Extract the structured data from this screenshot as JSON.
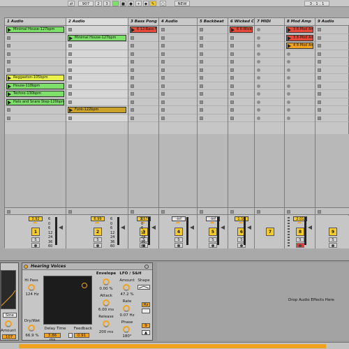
{
  "toolbar": {
    "bpm": "907",
    "bar_position": "2",
    "beat_position": "3",
    "new_button": "NEW",
    "right_position": "3 . 1 . 1"
  },
  "tracks": [
    {
      "name": "1 Audio",
      "clips": [
        {
          "row": 1,
          "label": "Minimal House-127bpm",
          "color": "#7ee06a"
        },
        {
          "row": 7,
          "label": "Reggaeton-105bpm",
          "color": "#e8f24a"
        },
        {
          "row": 8,
          "label": "House-118bpm",
          "color": "#7ee06a"
        },
        {
          "row": 9,
          "label": "Techno-130bpm",
          "color": "#7ee06a"
        },
        {
          "row": 10,
          "label": "Hats and Snare Step-129bpm",
          "color": "#7ee06a"
        }
      ],
      "volume": "3.92",
      "number": "1"
    },
    {
      "name": "2 Audio",
      "clips": [
        {
          "row": 2,
          "label": "Minimal House-127bpm",
          "color": "#7ee06a"
        },
        {
          "row": 11,
          "label": "Funk-122bpm",
          "color": "#c9a227"
        }
      ],
      "volume": "6.99",
      "number": "2"
    },
    {
      "name": "3 Bass Pong",
      "clips": [
        {
          "row": 1,
          "label": "6 12-Bass F",
          "color": "#e84a3a"
        }
      ],
      "volume": "1.57",
      "number": "3"
    },
    {
      "name": "4 Audio",
      "clips": [],
      "volume": "-inf",
      "number": "4"
    },
    {
      "name": "5 Backbeat",
      "clips": [],
      "volume": "-inf",
      "number": "5"
    },
    {
      "name": "6 Wicked Chi",
      "clips": [
        {
          "row": 1,
          "label": "6 6-Wicked I",
          "color": "#e84a3a"
        }
      ],
      "volume": "1.10",
      "number": "6"
    },
    {
      "name": "7 MIDI",
      "clips": [],
      "volume": "",
      "number": "7"
    },
    {
      "name": "8 Mod Amp",
      "clips": [
        {
          "row": 1,
          "label": "3 6-Mod Am",
          "color": "#e84a3a"
        },
        {
          "row": 2,
          "label": "3 8-Mod Am",
          "color": "#e84a3a"
        },
        {
          "row": 3,
          "label": "4 8-Mod Am",
          "color": "#f2a21c"
        }
      ],
      "volume": "2.01",
      "number": "8"
    },
    {
      "name": "9 Audio",
      "clips": [],
      "volume": "",
      "number": "9"
    }
  ],
  "meter_scale": [
    "6",
    "0",
    "6",
    "12",
    "24",
    "36",
    "60"
  ],
  "left_device": {
    "sine_label": "Sine",
    "amount_label": "Amount",
    "amount_value": "107"
  },
  "device": {
    "title": "Hearing Voices",
    "hi_pass_label": "Hi Pass",
    "hi_pass_value": "124 Hz",
    "dry_wet_label": "Dry/Wet",
    "dry_wet_value": "66.9 %",
    "delay_time_label": "Delay Time",
    "delay_time_value": "3.86 ms",
    "feedback_label": "Feedback",
    "feedback_value": "0.91",
    "envelope_label": "Envelope",
    "envelope_value": "0.00 %",
    "attack_label": "Attack",
    "attack_value": "6.00 ms",
    "release_label": "Release",
    "release_value": "200 ms",
    "lfo_label": "LFO / S&H",
    "lfo_amount_label": "Amount",
    "lfo_amount_value": "47.2 %",
    "shape_label": "Shape",
    "rate_label": "Rate",
    "rate_value": "0.07 Hz",
    "hz_label": "Hz",
    "phase_label": "Phase",
    "phase_value": "180°"
  },
  "drop_zone": "Drop Audio Effects Here"
}
